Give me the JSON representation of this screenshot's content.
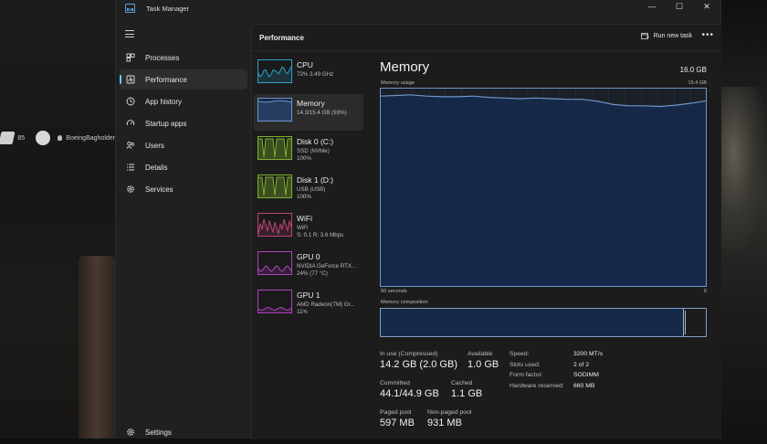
{
  "window": {
    "title": "Task Manager",
    "controls": [
      "—",
      "☐",
      "✕"
    ]
  },
  "background_hud": {
    "count": "85",
    "player": "BoeingBagholder"
  },
  "sidebar": {
    "items": [
      {
        "label": "Processes",
        "icon": "processes-grid-icon"
      },
      {
        "label": "Performance",
        "icon": "performance-pulse-icon",
        "active": true
      },
      {
        "label": "App history",
        "icon": "history-clock-icon"
      },
      {
        "label": "Startup apps",
        "icon": "startup-gauge-icon"
      },
      {
        "label": "Users",
        "icon": "users-icon"
      },
      {
        "label": "Details",
        "icon": "details-list-icon"
      },
      {
        "label": "Services",
        "icon": "services-gear-icon"
      }
    ],
    "settings_label": "Settings"
  },
  "header": {
    "title": "Performance",
    "run_new_task": "Run new task",
    "more": "•••"
  },
  "devices": [
    {
      "name": "CPU",
      "sub": "72% 3.49 GHz",
      "sub2": "",
      "color": "#2fa3c7"
    },
    {
      "name": "Memory",
      "sub": "14.3/15.4 GB (93%)",
      "sub2": "",
      "color": "#6f95c8",
      "active": true
    },
    {
      "name": "Disk 0 (C:)",
      "sub": "SSD (NVMe)",
      "sub2": "100%",
      "color": "#7eb12e"
    },
    {
      "name": "Disk 1 (D:)",
      "sub": "USB (USB)",
      "sub2": "100%",
      "color": "#7eb12e"
    },
    {
      "name": "WiFi",
      "sub": "WiFi",
      "sub2": "S: 0.1 R: 3.6 Mbps",
      "color": "#c0427a"
    },
    {
      "name": "GPU 0",
      "sub": "NVIDIA GeForce RTX...",
      "sub2": "24% (77 °C)",
      "color": "#b242c0"
    },
    {
      "name": "GPU 1",
      "sub": "AMD Radeon(TM) Gr...",
      "sub2": "11%",
      "color": "#b242c0"
    }
  ],
  "detail": {
    "title": "Memory",
    "total": "16.0 GB",
    "usage_label": "Memory usage",
    "usage_max": "15.4 GB",
    "time_left": "60 seconds",
    "time_right": "0",
    "composition_label": "Memory composition",
    "composition_used_fraction": 0.93,
    "composition_free_from": 0.935,
    "stats": {
      "in_use_label": "In use (Compressed)",
      "in_use_value": "14.2 GB (2.0 GB)",
      "available_label": "Available",
      "available_value": "1.0 GB",
      "committed_label": "Committed",
      "committed_value": "44.1/44.9 GB",
      "cached_label": "Cached",
      "cached_value": "1.1 GB",
      "paged_label": "Paged pool",
      "paged_value": "597 MB",
      "nonpaged_label": "Non-paged pool",
      "nonpaged_value": "931 MB"
    },
    "specs": [
      {
        "k": "Speed:",
        "v": "3200 MT/s"
      },
      {
        "k": "Slots used:",
        "v": "2 of 2"
      },
      {
        "k": "Form factor:",
        "v": "SODIMM"
      },
      {
        "k": "Hardware reserved:",
        "v": "660 MB"
      }
    ]
  },
  "chart_data": {
    "type": "area",
    "ylim": [
      0,
      15.4
    ],
    "values": [
      14.75,
      14.8,
      14.85,
      14.75,
      14.7,
      14.7,
      14.75,
      14.65,
      14.6,
      14.55,
      14.6,
      14.55,
      14.5,
      14.5,
      14.35,
      14.1,
      14.0,
      14.0,
      13.95,
      14.05,
      14.2,
      14.4
    ],
    "colors": {
      "line": "#6f95c8",
      "fill": "#16294a",
      "grid": "#2a3a52"
    }
  }
}
